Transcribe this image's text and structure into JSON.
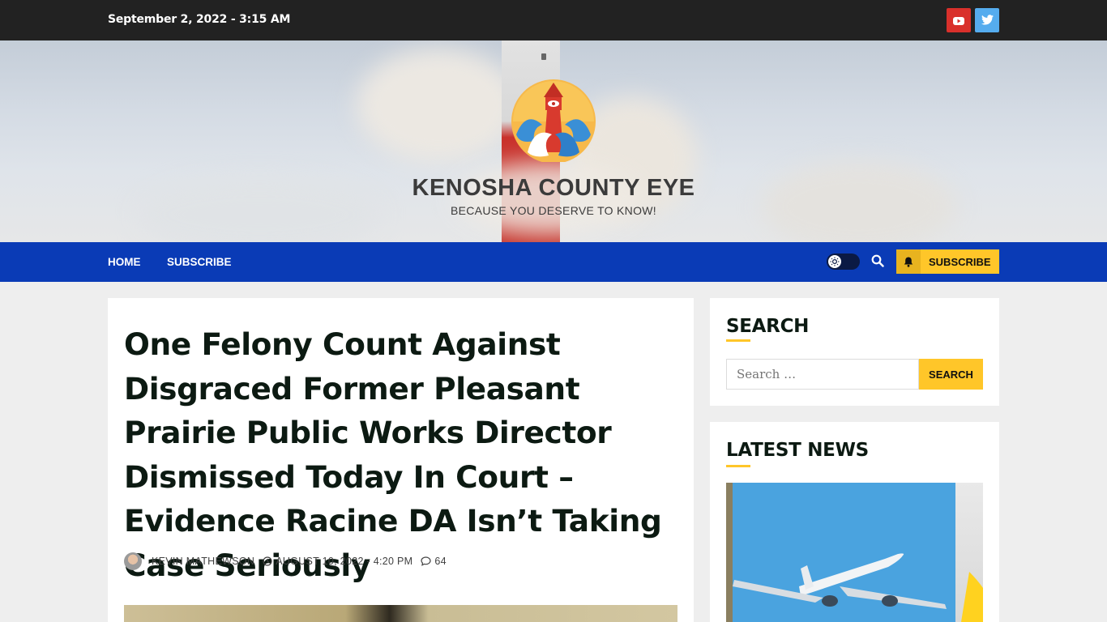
{
  "topbar": {
    "datetime": "September 2, 2022 - 3:15 AM",
    "social": [
      {
        "name": "youtube-icon",
        "color": "#d9302b"
      },
      {
        "name": "twitter-icon",
        "color": "#55acee"
      }
    ]
  },
  "header": {
    "site_title": "KENOSHA COUNTY EYE",
    "tagline": "BECAUSE YOU DESERVE TO KNOW!"
  },
  "nav": {
    "items": [
      "HOME",
      "SUBSCRIBE"
    ],
    "subscribe_button": "SUBSCRIBE",
    "colors": {
      "bar": "#0a3bb6",
      "accent": "#ffc629"
    }
  },
  "article": {
    "title": "One Felony Count Against Disgraced Former Pleasant Prairie Public Works Director Dismissed Today In Court – Evidence Racine DA Isn’t Taking Case Seriously",
    "author": "KEVIN MATHEWSON",
    "date": "AUGUST 10, 2022 - 4:20 PM",
    "comments": "64"
  },
  "sidebar": {
    "search": {
      "heading": "SEARCH",
      "placeholder": "Search …",
      "button": "SEARCH"
    },
    "latest": {
      "heading": "LATEST NEWS"
    }
  }
}
